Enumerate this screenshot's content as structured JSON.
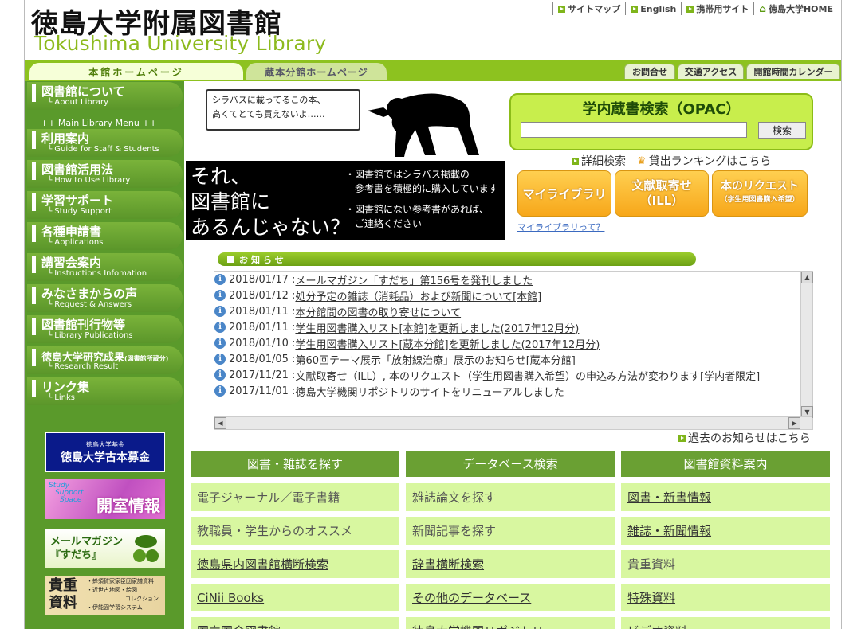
{
  "header": {
    "title_jp": "徳島大学附属図書館",
    "title_en": "Tokushima University Library",
    "links": [
      {
        "label": "サイトマップ",
        "icon": "arrow-box-icon"
      },
      {
        "label": "English",
        "icon": "arrow-box-icon"
      },
      {
        "label": "携帯用サイト",
        "icon": "arrow-box-icon"
      },
      {
        "label": "徳島大学HOME",
        "icon": "home-icon"
      }
    ]
  },
  "tabs": {
    "main": "本館ホームページ",
    "branch": "蔵本分館ホームページ",
    "right": [
      "お問合せ",
      "交通アクセス",
      "開館時間カレンダー"
    ]
  },
  "sidebar": {
    "about": {
      "jp": "図書館について",
      "en": "About Library"
    },
    "menu_label": "++ Main Library Menu ++",
    "items": [
      {
        "jp": "利用案内",
        "en": "Guide for Staff & Students"
      },
      {
        "jp": "図書館活用法",
        "en": "How to Use Library"
      },
      {
        "jp": "学習サポート",
        "en": "Study Support"
      },
      {
        "jp": "各種申請書",
        "en": "Applications"
      },
      {
        "jp": "講習会案内",
        "en": "Instructions Infomation"
      },
      {
        "jp": "みなさまからの声",
        "en": "Request & Answers"
      },
      {
        "jp": "図書館刊行物等",
        "en": "Library Publications"
      },
      {
        "jp": "徳島大学研究成果",
        "jp_small": "(図書館所蔵分)",
        "en": "Research Result"
      },
      {
        "jp": "リンク集",
        "en": "Links"
      }
    ],
    "banners": {
      "fund_small": "徳島大学基金",
      "fund_big": "徳島大学古本募金",
      "study_a": "Study",
      "study_b": "Support",
      "study_c": "Space",
      "study_main": "開室情報",
      "mag_a": "メールマガジン",
      "mag_b": "『すだち』",
      "rare_big_a": "貴重",
      "rare_big_b": "資料",
      "rare_lines": [
        "・蜂須賀家家臣団家譜資料",
        "・近世古地図・絵図",
        "コレクション",
        "・伊能図学習システム"
      ]
    }
  },
  "ad": {
    "bubble_line1": "シラバスに載ってるこの本、",
    "bubble_line2": "高くてとても買えないよ……",
    "big_line1": "それ、",
    "big_line2": "図書館に",
    "big_line3": "あるんじゃない？",
    "small_lines": [
      "・図書館ではシラバス掲載の",
      "　参考書を積極的に購入しています",
      "",
      "・図書館にない参考書があれば、",
      "　ご連絡ください"
    ]
  },
  "opac": {
    "title": "学内蔵書検索（OPAC）",
    "search_value": "",
    "search_button": "検索",
    "detail_link": "詳細検索",
    "ranking_link": "貸出ランキングはこちら"
  },
  "buttons": {
    "mylibrary": "マイライブラリ",
    "ill_a": "文献取寄せ",
    "ill_b": "（ILL）",
    "request_a": "本のリクエスト",
    "request_b": "（学生用図書購入希望）",
    "mylibrary_help": "マイライブラリって？"
  },
  "news": {
    "heading": "お知らせ",
    "items": [
      {
        "date": "2018/01/17 : ",
        "text": "メールマガジン「すだち」第156号を発刊しました"
      },
      {
        "date": "2018/01/12 : ",
        "text": "処分予定の雑誌（消耗品）および新聞について[本館]"
      },
      {
        "date": "2018/01/11 : ",
        "text": "本分館間の図書の取り寄せについて"
      },
      {
        "date": "2018/01/11 : ",
        "text": "学生用図書購入リスト[本館]を更新しました(2017年12月分)"
      },
      {
        "date": "2018/01/10 : ",
        "text": "学生用図書購入リスト[蔵本分館]を更新しました(2017年12月分)"
      },
      {
        "date": "2018/01/05 : ",
        "text": "第60回テーマ展示「放射線治療」展示のお知らせ[蔵本分館]"
      },
      {
        "date": "2017/11/21 : ",
        "text": "文献取寄せ（ILL）, 本のリクエスト（学生用図書購入希望）の申込み方法が変わります[学内者限定]"
      },
      {
        "date": "2017/11/01 : ",
        "text": "徳島大学機関リポジトリのサイトをリニューアルしました"
      }
    ],
    "past_link": "過去のお知らせはこちら"
  },
  "categories": [
    {
      "title": "図書・雑誌を探す",
      "items": [
        {
          "label": "電子ジャーナル／電子書籍",
          "link": false
        },
        {
          "label": "教職員・学生からのオススメ",
          "link": false
        },
        {
          "label": "徳島県内図書館横断検索",
          "link": true
        },
        {
          "label": "CiNii Books",
          "link": true
        },
        {
          "label": "国立国会図書館",
          "link": true
        }
      ]
    },
    {
      "title": "データベース検索",
      "items": [
        {
          "label": "雑誌論文を探す",
          "link": false
        },
        {
          "label": "新聞記事を探す",
          "link": false
        },
        {
          "label": "辞書横断検索",
          "link": true
        },
        {
          "label": "その他のデータベース",
          "link": true
        },
        {
          "label": "徳島大学機関リポジトリ",
          "link": true
        }
      ]
    },
    {
      "title": "図書館資料案内",
      "items": [
        {
          "label": "図書・新書情報",
          "link": true
        },
        {
          "label": "雑誌・新聞情報",
          "link": true
        },
        {
          "label": "貴重資料",
          "link": false
        },
        {
          "label": "特殊資料",
          "link": true
        },
        {
          "label": "ビデオ資料",
          "link": true
        }
      ]
    }
  ]
}
